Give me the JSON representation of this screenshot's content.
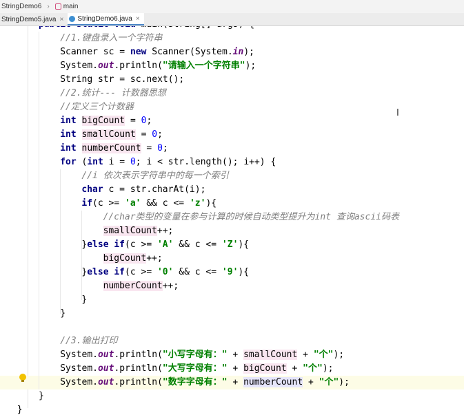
{
  "breadcrumb": {
    "file": "StringDemo6",
    "method": "main"
  },
  "tabs": [
    {
      "label": "StringDemo5.java",
      "active": false
    },
    {
      "label": "StringDemo6.java",
      "active": true
    }
  ],
  "code_lines": [
    {
      "indent": 8,
      "html": "<span class=\"kw\">public static void</span> main(String[] args) {"
    },
    {
      "indent": 12,
      "html": "<span class=\"cm\">//1.键盘录入一个字符串</span>"
    },
    {
      "indent": 12,
      "html": "Scanner sc = <span class=\"kw\">new</span> Scanner(System.<span class=\"fld\">in</span>);"
    },
    {
      "indent": 12,
      "html": "System.<span class=\"fld\">out</span>.println(<span class=\"st\">\"请输入一个字符串\"</span>);"
    },
    {
      "indent": 12,
      "html": "String str = sc.next();"
    },
    {
      "indent": 12,
      "html": "<span class=\"cm\">//2.统计--- 计数器思想</span>"
    },
    {
      "indent": 12,
      "html": "<span class=\"cm\">//定义三个计数器</span>"
    },
    {
      "indent": 12,
      "html": "<span class=\"kw\">int</span> <span class=\"var\">bigCount</span> = <span class=\"nm\">0</span>;"
    },
    {
      "indent": 12,
      "html": "<span class=\"kw\">int</span> <span class=\"var\">smallCount</span> = <span class=\"nm\">0</span>;"
    },
    {
      "indent": 12,
      "html": "<span class=\"kw\">int</span> <span class=\"var\">numberCount</span> = <span class=\"nm\">0</span>;"
    },
    {
      "indent": 12,
      "html": "<span class=\"kw\">for</span> (<span class=\"kw\">int</span> i = <span class=\"nm\">0</span>; i &lt; str.length(); i++) {"
    },
    {
      "indent": 16,
      "html": "<span class=\"cm\">//i 依次表示字符串中的每一个索引</span>"
    },
    {
      "indent": 16,
      "html": "<span class=\"kw\">char</span> c = str.charAt(i);"
    },
    {
      "indent": 16,
      "html": "<span class=\"kw\">if</span>(c &gt;= <span class=\"st\">'a'</span> &amp;&amp; c &lt;= <span class=\"st\">'z'</span>){"
    },
    {
      "indent": 20,
      "html": "<span class=\"cm\">//char类型的变量在参与计算的时候自动类型提升为int 查询ascii码表</span>"
    },
    {
      "indent": 20,
      "html": "<span class=\"var\">smallCount</span>++;"
    },
    {
      "indent": 16,
      "html": "}<span class=\"kw\">else if</span>(c &gt;= <span class=\"st\">'A'</span> &amp;&amp; c &lt;= <span class=\"st\">'Z'</span>){"
    },
    {
      "indent": 20,
      "html": "<span class=\"var\">bigCount</span>++;"
    },
    {
      "indent": 16,
      "html": "}<span class=\"kw\">else if</span>(c &gt;= <span class=\"st\">'0'</span> &amp;&amp; c &lt;= <span class=\"st\">'9'</span>){"
    },
    {
      "indent": 20,
      "html": "<span class=\"var\">numberCount</span>++;"
    },
    {
      "indent": 16,
      "html": "}"
    },
    {
      "indent": 12,
      "html": "}"
    },
    {
      "indent": 12,
      "html": ""
    },
    {
      "indent": 12,
      "html": "<span class=\"cm\">//3.输出打印</span>"
    },
    {
      "indent": 12,
      "html": "System.<span class=\"fld\">out</span>.println(<span class=\"st\">\"小写字母有：\"</span> + <span class=\"var\">smallCount</span> + <span class=\"st\">\"个\"</span>);"
    },
    {
      "indent": 12,
      "html": "System.<span class=\"fld\">out</span>.println(<span class=\"st\">\"大写字母有：\"</span> + <span class=\"var\">bigCount</span> + <span class=\"st\">\"个\"</span>);"
    },
    {
      "indent": 12,
      "html": "System.<span class=\"fld\">out</span>.println(<span class=\"st\">\"数字字母有：\"</span> + <span class=\"ref\">numberCount</span> + <span class=\"st\">\"个\"</span>);",
      "current": true
    },
    {
      "indent": 8,
      "html": "}"
    },
    {
      "indent": 4,
      "html": "}"
    }
  ]
}
